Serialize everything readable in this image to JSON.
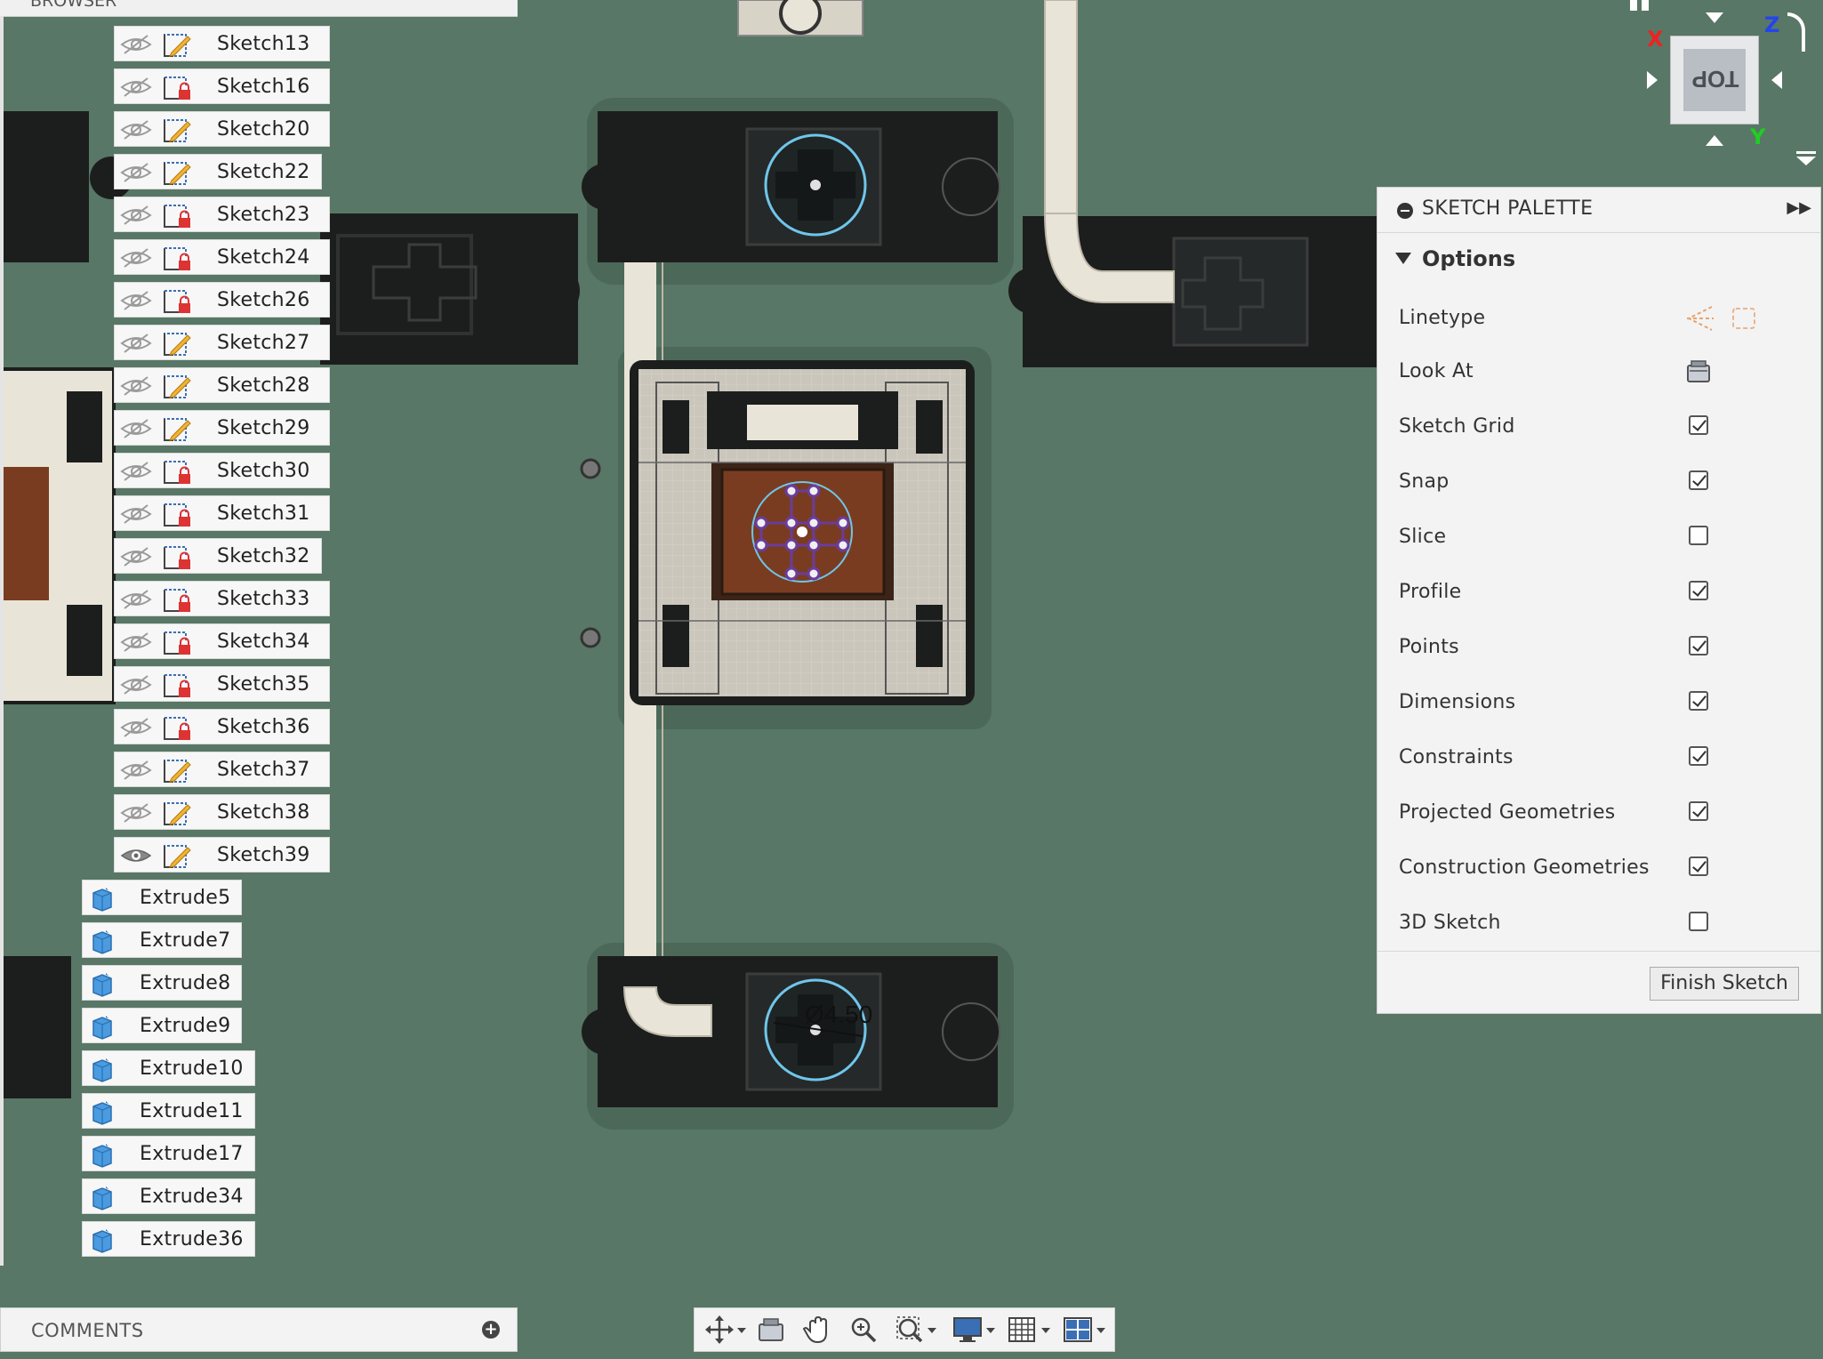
{
  "browser": {
    "header_label": "BROWSER",
    "sketches": [
      {
        "label": "Sketch13",
        "icon": "sketch-edit-icon",
        "visible": false
      },
      {
        "label": "Sketch16",
        "icon": "sketch-locked-icon",
        "visible": false
      },
      {
        "label": "Sketch20",
        "icon": "sketch-edit-icon",
        "visible": false
      },
      {
        "label": "Sketch22",
        "icon": "sketch-edit-icon",
        "visible": false
      },
      {
        "label": "Sketch23",
        "icon": "sketch-locked-icon",
        "visible": false
      },
      {
        "label": "Sketch24",
        "icon": "sketch-locked-icon",
        "visible": false
      },
      {
        "label": "Sketch26",
        "icon": "sketch-locked-icon",
        "visible": false
      },
      {
        "label": "Sketch27",
        "icon": "sketch-edit-icon",
        "visible": false
      },
      {
        "label": "Sketch28",
        "icon": "sketch-edit-icon",
        "visible": false
      },
      {
        "label": "Sketch29",
        "icon": "sketch-edit-icon",
        "visible": false
      },
      {
        "label": "Sketch30",
        "icon": "sketch-locked-icon",
        "visible": false
      },
      {
        "label": "Sketch31",
        "icon": "sketch-locked-icon",
        "visible": false
      },
      {
        "label": "Sketch32",
        "icon": "sketch-locked-icon",
        "visible": false
      },
      {
        "label": "Sketch33",
        "icon": "sketch-locked-icon",
        "visible": false
      },
      {
        "label": "Sketch34",
        "icon": "sketch-locked-icon",
        "visible": false
      },
      {
        "label": "Sketch35",
        "icon": "sketch-locked-icon",
        "visible": false
      },
      {
        "label": "Sketch36",
        "icon": "sketch-locked-icon",
        "visible": false
      },
      {
        "label": "Sketch37",
        "icon": "sketch-edit-icon",
        "visible": false
      },
      {
        "label": "Sketch38",
        "icon": "sketch-edit-icon",
        "visible": false
      },
      {
        "label": "Sketch39",
        "icon": "sketch-edit-icon",
        "visible": true
      }
    ],
    "extrudes": [
      {
        "label": "Extrude5"
      },
      {
        "label": "Extrude7"
      },
      {
        "label": "Extrude8"
      },
      {
        "label": "Extrude9"
      },
      {
        "label": "Extrude10"
      },
      {
        "label": "Extrude11"
      },
      {
        "label": "Extrude17"
      },
      {
        "label": "Extrude34"
      },
      {
        "label": "Extrude36"
      }
    ]
  },
  "comments": {
    "label": "COMMENTS"
  },
  "palette": {
    "title": "SKETCH PALETTE",
    "section": "Options",
    "linetype_label": "Linetype",
    "lookat_label": "Look At",
    "options": [
      {
        "label": "Sketch Grid",
        "checked": true
      },
      {
        "label": "Snap",
        "checked": true
      },
      {
        "label": "Slice",
        "checked": false
      },
      {
        "label": "Profile",
        "checked": true
      },
      {
        "label": "Points",
        "checked": true
      },
      {
        "label": "Dimensions",
        "checked": true
      },
      {
        "label": "Constraints",
        "checked": true
      },
      {
        "label": "Projected Geometries",
        "checked": true
      },
      {
        "label": "Construction Geometries",
        "checked": true
      },
      {
        "label": "3D Sketch",
        "checked": false
      }
    ],
    "finish_label": "Finish Sketch"
  },
  "viewcube": {
    "face_label": "TOP",
    "x_label": "X",
    "y_label": "Y",
    "z_label": "Z"
  },
  "viewport": {
    "dimension_text": "Ø4.50"
  },
  "colors": {
    "background": "#587766",
    "part_dark": "#1c1e1d",
    "tube": "#e9e4d8",
    "wood": "#7a3c20",
    "sketch_circle": "#6fc6ea",
    "constraint_point": "#6a3c9c"
  }
}
